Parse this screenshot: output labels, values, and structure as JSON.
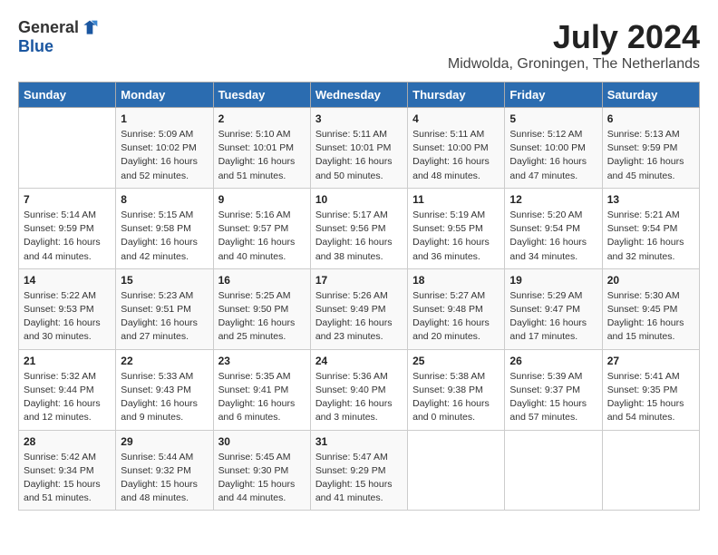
{
  "logo": {
    "general": "General",
    "blue": "Blue"
  },
  "title": {
    "month_year": "July 2024",
    "location": "Midwolda, Groningen, The Netherlands"
  },
  "header_days": [
    "Sunday",
    "Monday",
    "Tuesday",
    "Wednesday",
    "Thursday",
    "Friday",
    "Saturday"
  ],
  "weeks": [
    [
      {
        "day": "",
        "sunrise": "",
        "sunset": "",
        "daylight": ""
      },
      {
        "day": "1",
        "sunrise": "Sunrise: 5:09 AM",
        "sunset": "Sunset: 10:02 PM",
        "daylight": "Daylight: 16 hours and 52 minutes."
      },
      {
        "day": "2",
        "sunrise": "Sunrise: 5:10 AM",
        "sunset": "Sunset: 10:01 PM",
        "daylight": "Daylight: 16 hours and 51 minutes."
      },
      {
        "day": "3",
        "sunrise": "Sunrise: 5:11 AM",
        "sunset": "Sunset: 10:01 PM",
        "daylight": "Daylight: 16 hours and 50 minutes."
      },
      {
        "day": "4",
        "sunrise": "Sunrise: 5:11 AM",
        "sunset": "Sunset: 10:00 PM",
        "daylight": "Daylight: 16 hours and 48 minutes."
      },
      {
        "day": "5",
        "sunrise": "Sunrise: 5:12 AM",
        "sunset": "Sunset: 10:00 PM",
        "daylight": "Daylight: 16 hours and 47 minutes."
      },
      {
        "day": "6",
        "sunrise": "Sunrise: 5:13 AM",
        "sunset": "Sunset: 9:59 PM",
        "daylight": "Daylight: 16 hours and 45 minutes."
      }
    ],
    [
      {
        "day": "7",
        "sunrise": "Sunrise: 5:14 AM",
        "sunset": "Sunset: 9:59 PM",
        "daylight": "Daylight: 16 hours and 44 minutes."
      },
      {
        "day": "8",
        "sunrise": "Sunrise: 5:15 AM",
        "sunset": "Sunset: 9:58 PM",
        "daylight": "Daylight: 16 hours and 42 minutes."
      },
      {
        "day": "9",
        "sunrise": "Sunrise: 5:16 AM",
        "sunset": "Sunset: 9:57 PM",
        "daylight": "Daylight: 16 hours and 40 minutes."
      },
      {
        "day": "10",
        "sunrise": "Sunrise: 5:17 AM",
        "sunset": "Sunset: 9:56 PM",
        "daylight": "Daylight: 16 hours and 38 minutes."
      },
      {
        "day": "11",
        "sunrise": "Sunrise: 5:19 AM",
        "sunset": "Sunset: 9:55 PM",
        "daylight": "Daylight: 16 hours and 36 minutes."
      },
      {
        "day": "12",
        "sunrise": "Sunrise: 5:20 AM",
        "sunset": "Sunset: 9:54 PM",
        "daylight": "Daylight: 16 hours and 34 minutes."
      },
      {
        "day": "13",
        "sunrise": "Sunrise: 5:21 AM",
        "sunset": "Sunset: 9:54 PM",
        "daylight": "Daylight: 16 hours and 32 minutes."
      }
    ],
    [
      {
        "day": "14",
        "sunrise": "Sunrise: 5:22 AM",
        "sunset": "Sunset: 9:53 PM",
        "daylight": "Daylight: 16 hours and 30 minutes."
      },
      {
        "day": "15",
        "sunrise": "Sunrise: 5:23 AM",
        "sunset": "Sunset: 9:51 PM",
        "daylight": "Daylight: 16 hours and 27 minutes."
      },
      {
        "day": "16",
        "sunrise": "Sunrise: 5:25 AM",
        "sunset": "Sunset: 9:50 PM",
        "daylight": "Daylight: 16 hours and 25 minutes."
      },
      {
        "day": "17",
        "sunrise": "Sunrise: 5:26 AM",
        "sunset": "Sunset: 9:49 PM",
        "daylight": "Daylight: 16 hours and 23 minutes."
      },
      {
        "day": "18",
        "sunrise": "Sunrise: 5:27 AM",
        "sunset": "Sunset: 9:48 PM",
        "daylight": "Daylight: 16 hours and 20 minutes."
      },
      {
        "day": "19",
        "sunrise": "Sunrise: 5:29 AM",
        "sunset": "Sunset: 9:47 PM",
        "daylight": "Daylight: 16 hours and 17 minutes."
      },
      {
        "day": "20",
        "sunrise": "Sunrise: 5:30 AM",
        "sunset": "Sunset: 9:45 PM",
        "daylight": "Daylight: 16 hours and 15 minutes."
      }
    ],
    [
      {
        "day": "21",
        "sunrise": "Sunrise: 5:32 AM",
        "sunset": "Sunset: 9:44 PM",
        "daylight": "Daylight: 16 hours and 12 minutes."
      },
      {
        "day": "22",
        "sunrise": "Sunrise: 5:33 AM",
        "sunset": "Sunset: 9:43 PM",
        "daylight": "Daylight: 16 hours and 9 minutes."
      },
      {
        "day": "23",
        "sunrise": "Sunrise: 5:35 AM",
        "sunset": "Sunset: 9:41 PM",
        "daylight": "Daylight: 16 hours and 6 minutes."
      },
      {
        "day": "24",
        "sunrise": "Sunrise: 5:36 AM",
        "sunset": "Sunset: 9:40 PM",
        "daylight": "Daylight: 16 hours and 3 minutes."
      },
      {
        "day": "25",
        "sunrise": "Sunrise: 5:38 AM",
        "sunset": "Sunset: 9:38 PM",
        "daylight": "Daylight: 16 hours and 0 minutes."
      },
      {
        "day": "26",
        "sunrise": "Sunrise: 5:39 AM",
        "sunset": "Sunset: 9:37 PM",
        "daylight": "Daylight: 15 hours and 57 minutes."
      },
      {
        "day": "27",
        "sunrise": "Sunrise: 5:41 AM",
        "sunset": "Sunset: 9:35 PM",
        "daylight": "Daylight: 15 hours and 54 minutes."
      }
    ],
    [
      {
        "day": "28",
        "sunrise": "Sunrise: 5:42 AM",
        "sunset": "Sunset: 9:34 PM",
        "daylight": "Daylight: 15 hours and 51 minutes."
      },
      {
        "day": "29",
        "sunrise": "Sunrise: 5:44 AM",
        "sunset": "Sunset: 9:32 PM",
        "daylight": "Daylight: 15 hours and 48 minutes."
      },
      {
        "day": "30",
        "sunrise": "Sunrise: 5:45 AM",
        "sunset": "Sunset: 9:30 PM",
        "daylight": "Daylight: 15 hours and 44 minutes."
      },
      {
        "day": "31",
        "sunrise": "Sunrise: 5:47 AM",
        "sunset": "Sunset: 9:29 PM",
        "daylight": "Daylight: 15 hours and 41 minutes."
      },
      {
        "day": "",
        "sunrise": "",
        "sunset": "",
        "daylight": ""
      },
      {
        "day": "",
        "sunrise": "",
        "sunset": "",
        "daylight": ""
      },
      {
        "day": "",
        "sunrise": "",
        "sunset": "",
        "daylight": ""
      }
    ]
  ]
}
